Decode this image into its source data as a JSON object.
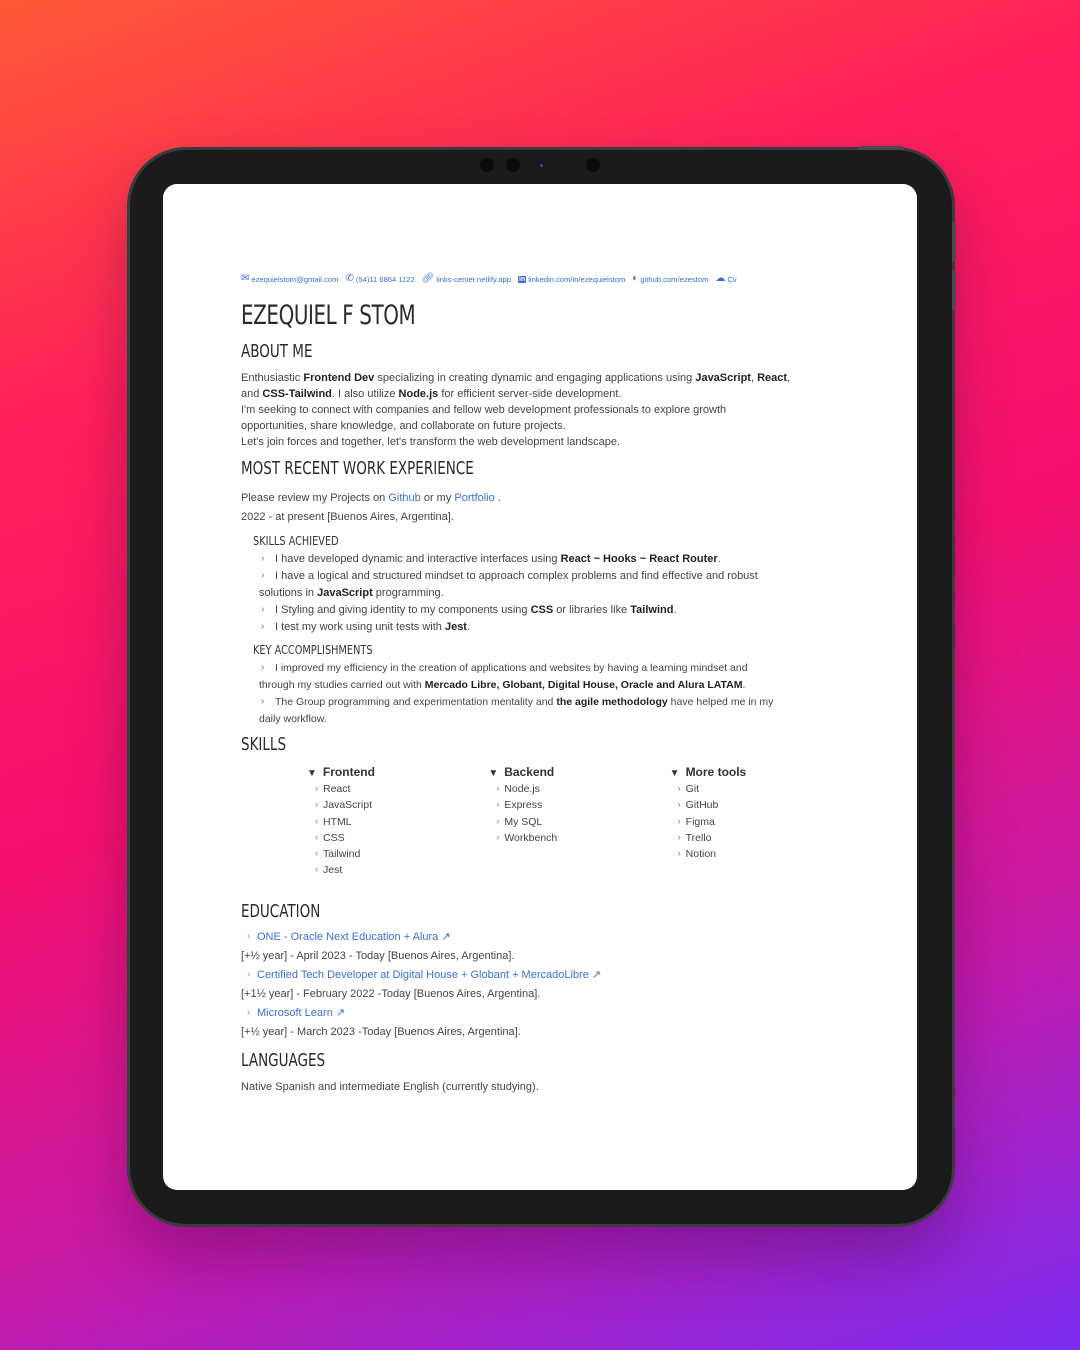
{
  "contact": {
    "email": "ezequielstom@gmail.com",
    "phone": "(54)11 6864 1122",
    "links": "links-center.netlify.app",
    "linkedin": "linkedin.com/in/ezequielstom",
    "github": "github.com/ezestom",
    "cv": "Cv"
  },
  "name": "EZEQUIEL F STOM",
  "about": {
    "heading": "ABOUT ME",
    "l1a": "Enthusiastic ",
    "l1b": "Frontend Dev",
    "l1c": " specializing in creating dynamic and engaging applications using ",
    "l1d": "JavaScript",
    "l1e": ", ",
    "l1f": "React",
    "l1g": ",",
    "l2a": "and ",
    "l2b": "CSS-Tailwind",
    "l2c": ". I also utilize ",
    "l2d": "Node.js",
    "l2e": " for efficient server-side development.",
    "l3": "I'm seeking to connect with companies and fellow web development professionals to explore growth",
    "l4": "opportunities, share knowledge, and collaborate on future projects.",
    "l5": "Let's join forces and together, let's transform the web development landscape."
  },
  "work": {
    "heading": "MOST RECENT WORK EXPERIENCE",
    "review_a": "Please review my Projects on ",
    "review_github": "Github",
    "review_b": " or my ",
    "review_portfolio": "Portfolio",
    "review_c": " .",
    "period": "2022 - at present [Buenos Aires, Argentina].",
    "skills_heading": "SKILLS ACHIEVED",
    "s1a": "I have developed dynamic and interactive interfaces using ",
    "s1b": "React ~ Hooks ~ React Router",
    "s1c": ".",
    "s2a": "I have a logical and structured mindset to approach complex problems and find effective and robust",
    "s2b": "solutions in ",
    "s2c": "JavaScript",
    "s2d": " programming.",
    "s3a": "I Styling and giving identity to my components using ",
    "s3b": "CSS",
    "s3c": " or libraries like ",
    "s3d": "Tailwind",
    "s3e": ".",
    "s4a": "I test my work using unit tests with ",
    "s4b": "Jest",
    "s4c": ".",
    "acc_heading": "KEY ACCOMPLISHMENTS",
    "a1a": "I improved my efficiency in the creation of applications and websites by having a learning mindset and",
    "a1b": "through my studies carried out with ",
    "a1c": "Mercado Libre, Globant, Digital House, Oracle and Alura LATAM",
    "a1d": ".",
    "a2a": "The Group programming and experimentation mentality and ",
    "a2b": "the agile methodology",
    "a2c": " have helped me in my",
    "a2d": "daily workflow."
  },
  "skills": {
    "heading": "SKILLS",
    "frontend": {
      "title": "Frontend",
      "items": [
        "React",
        "JavaScript",
        "HTML",
        "CSS",
        "Tailwind",
        "Jest"
      ]
    },
    "backend": {
      "title": "Backend",
      "items": [
        "Node.js",
        "Express",
        "My SQL",
        "Workbench"
      ]
    },
    "tools": {
      "title": "More tools",
      "items": [
        "Git",
        "GitHub",
        "Figma",
        "Trello",
        "Notion"
      ]
    }
  },
  "education": {
    "heading": "EDUCATION",
    "e1_link": "ONE - Oracle Next Education + Alura ↗",
    "e1_note": "[+½ year] - April 2023 - Today [Buenos Aires, Argentina].",
    "e2_link": "Certified Tech Developer at Digital House + Globant + MercadoLibre ↗",
    "e2_note": "[+1½ year] - February 2022 -Today [Buenos Aires, Argentina].",
    "e3_link": "Microsoft Learn ↗",
    "e3_note": "[+½ year] - March 2023 -Today [Buenos Aires, Argentina]."
  },
  "languages": {
    "heading": "LANGUAGES",
    "text": "Native Spanish and intermediate English (currently studying)."
  }
}
